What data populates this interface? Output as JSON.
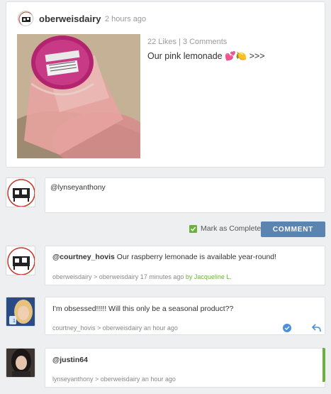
{
  "post": {
    "username": "oberweisdairy",
    "time": "2 hours ago",
    "stats": "22 Likes | 3 Comments",
    "caption": "Our pink lemonade 💕🍋 >>>"
  },
  "reply": {
    "value": "@lynseyanthony",
    "mark_complete_label": "Mark as Complete",
    "comment_button": "COMMENT"
  },
  "comments": [
    {
      "mention": "@courtney_hovis",
      "text": " Our raspberry lemonade is available year-round!",
      "meta": "oberweisdairy > oberweisdairy 17 minutes ago",
      "staff": "by Jacqueline L."
    },
    {
      "text": "I'm obsessed!!!!! Will this only be a seasonal product??",
      "meta": "courtney_hovis > oberweisdairy an hour ago"
    },
    {
      "mention": "@justin64",
      "meta": "lynseyanthony > oberweisdairy an hour ago"
    }
  ],
  "colors": {
    "accent_green": "#6ab23d",
    "button_blue": "#5b84b1",
    "check_icon_blue": "#4a90d9"
  }
}
